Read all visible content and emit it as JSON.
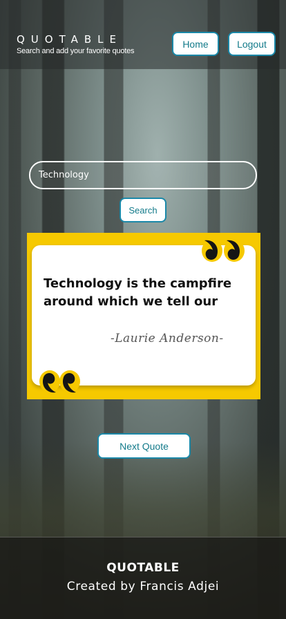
{
  "header": {
    "title": "QUOTABLE",
    "subtitle": "Search and add your favorite quotes",
    "home_label": "Home",
    "logout_label": "Logout"
  },
  "search": {
    "value": "Technology",
    "button_label": "Search"
  },
  "quote": {
    "text": "Technology is the campfire around which we tell our",
    "author": "-Laurie Anderson-",
    "accent_color": "#f6c900",
    "icons": [
      "quote-open-icon",
      "quote-close-icon"
    ]
  },
  "next_button_label": "Next Quote",
  "footer": {
    "title": "QUOTABLE",
    "credit": "Created by Francis Adjei"
  },
  "colors": {
    "button_text": "#127a8a",
    "button_border": "#1a88a8"
  }
}
